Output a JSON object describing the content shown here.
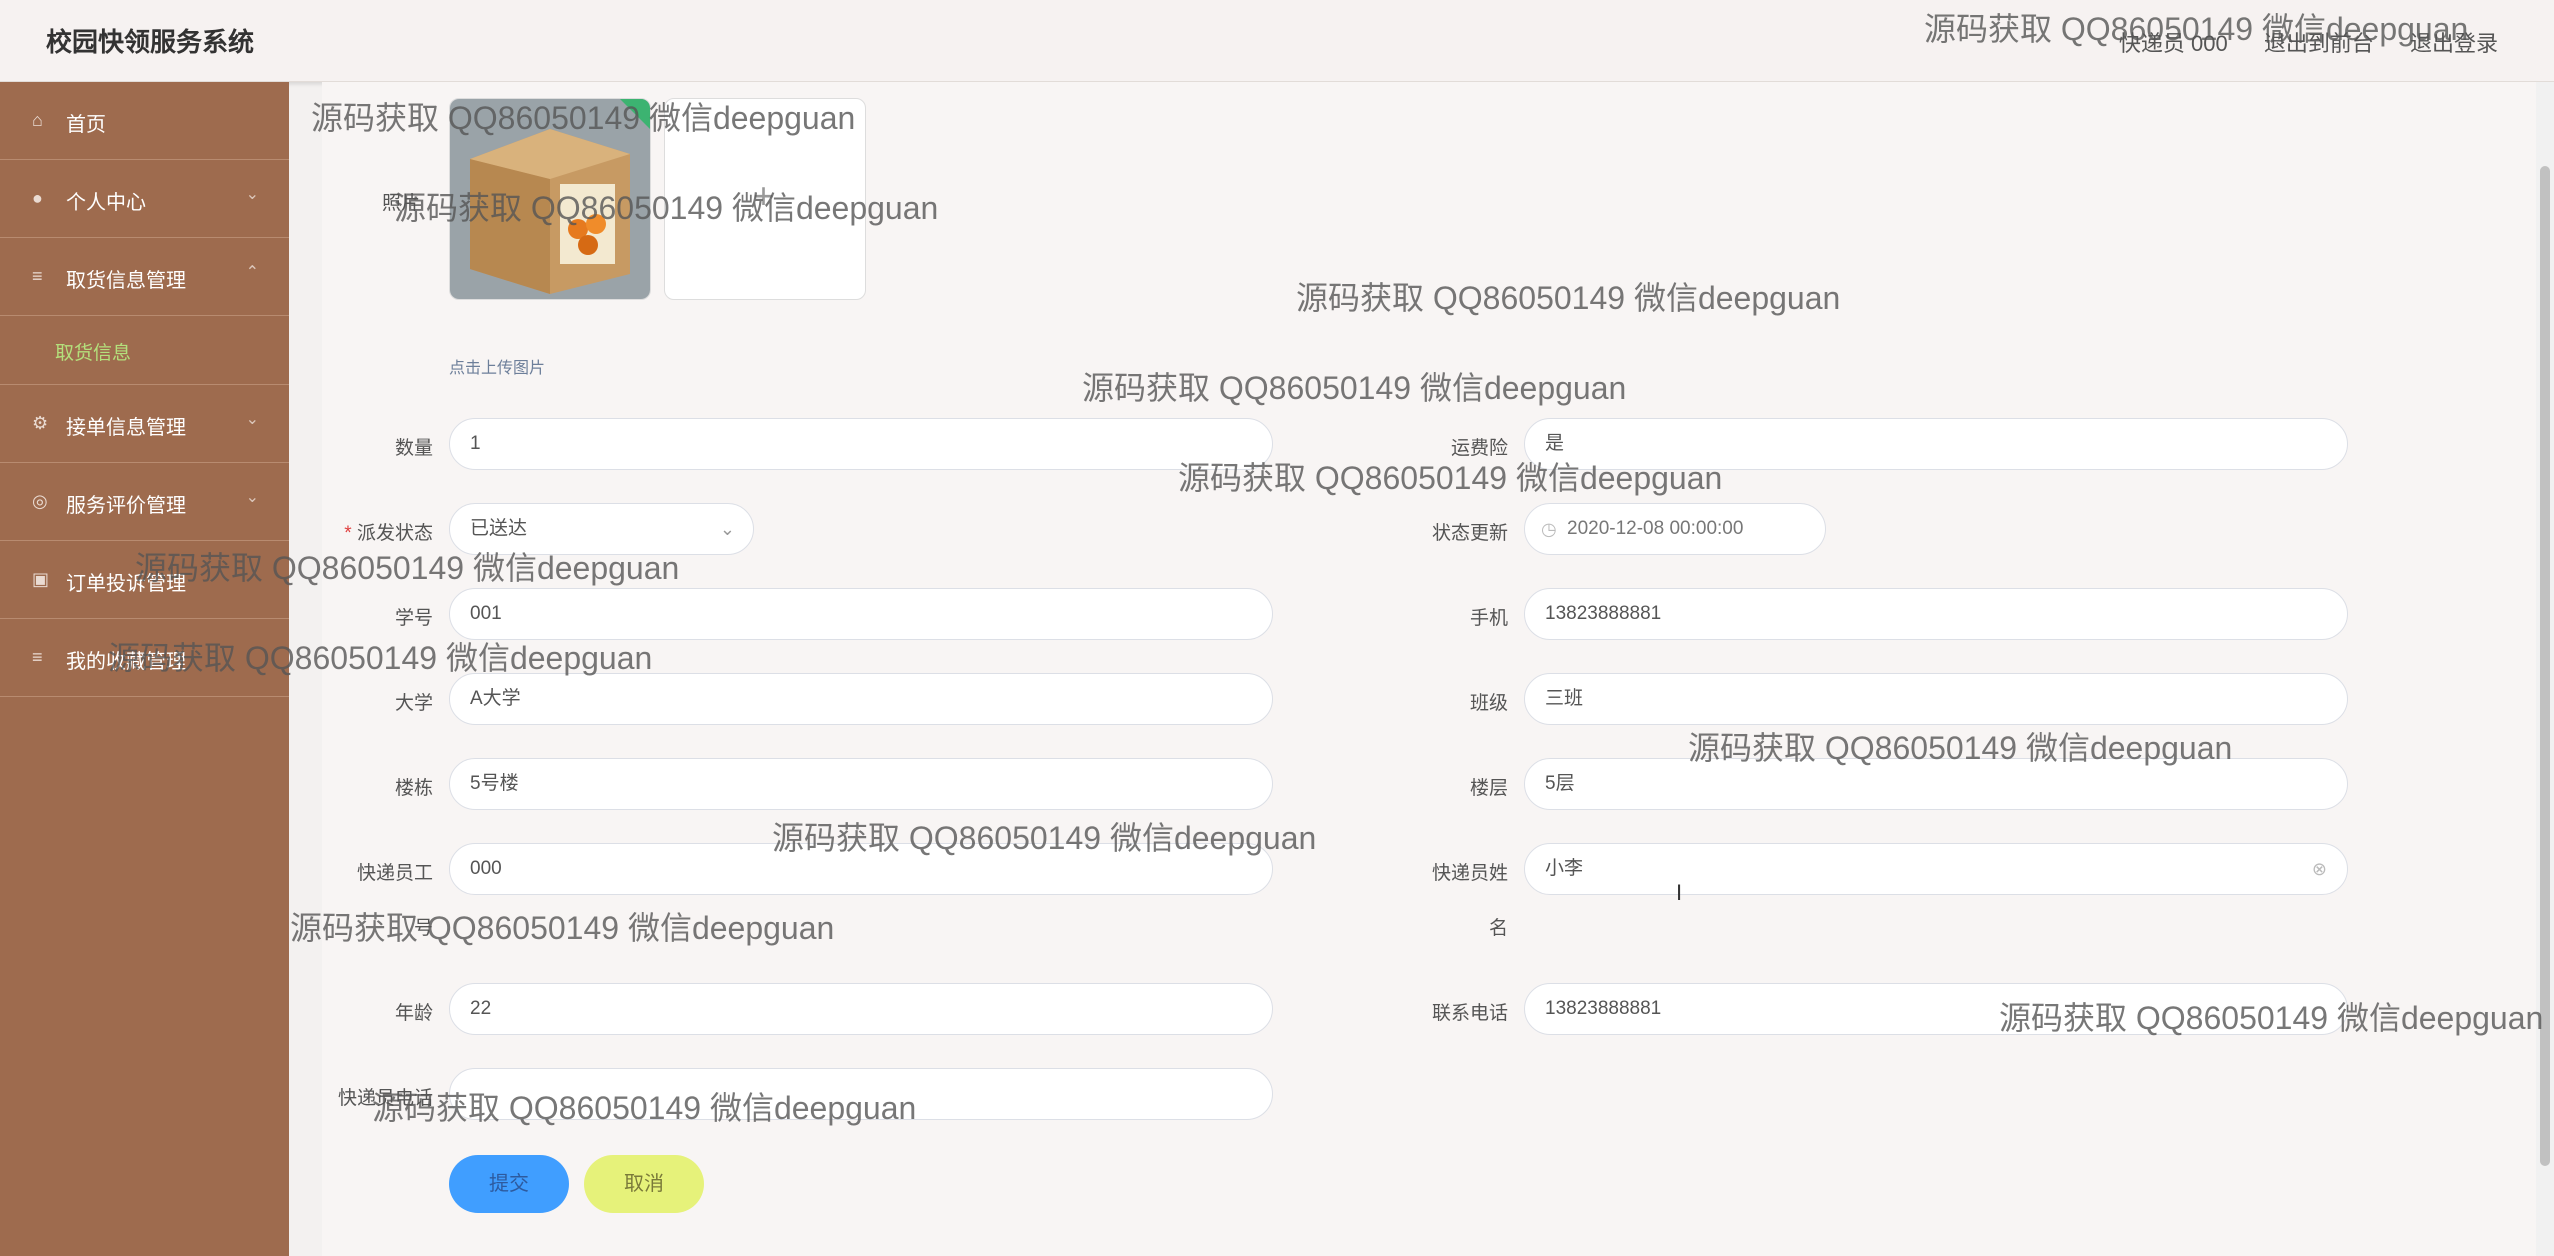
{
  "header": {
    "title": "校园快领服务系统",
    "user": "快递员 000",
    "front": "退出到前台",
    "logout": "退出登录"
  },
  "sidebar": {
    "items": [
      {
        "label": "首页"
      },
      {
        "label": "个人中心"
      },
      {
        "label": "取货信息管理"
      },
      {
        "label": "取货信息"
      },
      {
        "label": "接单信息管理"
      },
      {
        "label": "服务评价管理"
      },
      {
        "label": "订单投诉管理"
      },
      {
        "label": "我的收藏管理"
      }
    ]
  },
  "form": {
    "photo_label": "照片",
    "upload_tip": "点击上传图片",
    "upload_plus": "+",
    "quantity": {
      "label": "数量",
      "value": "1"
    },
    "freight_insurance": {
      "label": "运费险",
      "value": "是"
    },
    "status": {
      "label": "派发状态",
      "required": "*",
      "value": "已送达"
    },
    "status_update": {
      "label": "状态更新",
      "value": "2020-12-08 00:00:00"
    },
    "student_no": {
      "label": "学号",
      "value": "001"
    },
    "phone": {
      "label": "手机",
      "value": "13823888881"
    },
    "university": {
      "label": "大学",
      "value": "A大学"
    },
    "class": {
      "label": "班级",
      "value": "三班"
    },
    "building": {
      "label": "楼栋",
      "value": "5号楼"
    },
    "floor": {
      "label": "楼层",
      "value": "5层"
    },
    "courier_no": {
      "label_line1": "快递员工",
      "label_line2": "号",
      "value": "000"
    },
    "courier_name": {
      "label_line1": "快递员姓",
      "label_line2": "名",
      "value": "小李"
    },
    "age": {
      "label": "年龄",
      "value": "22"
    },
    "contact_phone": {
      "label": "联系电话",
      "value": "13823888881"
    },
    "courier_phone": {
      "label": "快递员电话",
      "value": ""
    },
    "submit": "提交",
    "cancel": "取消"
  },
  "watermarks": [
    "源码获取 QQ86050149 微信deepguan",
    "源码获取 QQ86050149 微信deepguan",
    "源码获取 QQ86050149 微信deepguan",
    "源码获取 QQ86050149 微信deepguan",
    "源码获取 QQ86050149 微信deepguan",
    "源码获取 QQ86050149 微信deepguan",
    "源码获取 QQ86050149 微信deepguan",
    "源码获取 QQ86050149 微信deepguan",
    "源码获取 QQ86050149 微信deepguan",
    "源码获取 QQ86050149 微信deepguan",
    "源码获取 QQ86050149 微信deepguan",
    "源码获取 QQ86050149 微信deepguan",
    "源码获取 QQ86050149 微信deepguan"
  ],
  "colors": {
    "sidebar": "#9e6b4e",
    "active_sub": "#b4e07c",
    "submit": "#409eff",
    "cancel": "#e6f27a"
  }
}
